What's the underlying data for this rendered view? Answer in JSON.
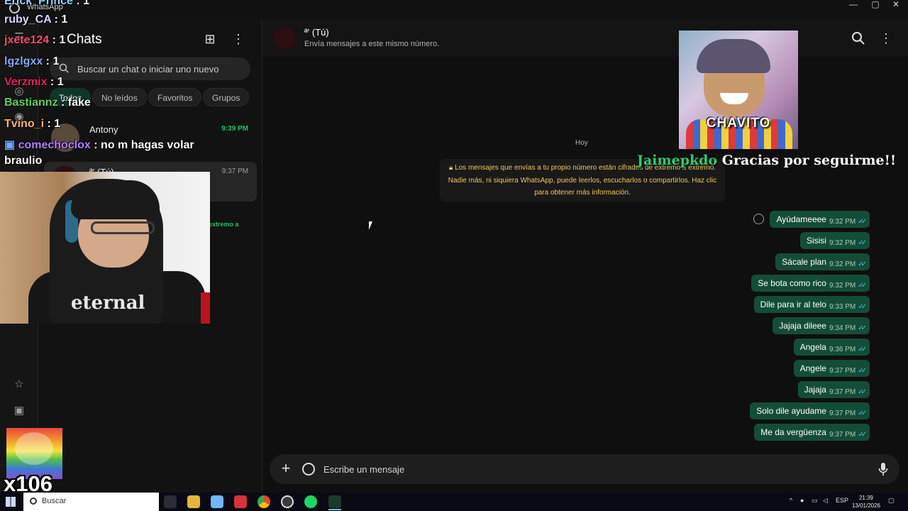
{
  "window": {
    "title": "WhatsApp"
  },
  "chatlist": {
    "title": "Chats",
    "search_placeholder": "Buscar un chat o iniciar uno nuevo",
    "filters": [
      "Todos",
      "No leídos",
      "Favoritos",
      "Grupos"
    ],
    "items": [
      {
        "name": "Antony",
        "time": "9:39 PM"
      },
      {
        "name": "ª' (Tú)",
        "time": "9:37 PM"
      }
    ],
    "snippet": "extremo a"
  },
  "chat": {
    "contact_name": "ª' (Tú)",
    "contact_subtitle": "Envía mensajes a este mismo número.",
    "day_label": "Hoy",
    "encryption_notice": "Los mensajes que envías a tu propio número están cifrados de extremo a extremo. Nadie más, ni siquiera WhatsApp, puede leerlos, escucharlos o compartirlos. Haz clic para obtener más información.",
    "messages": [
      {
        "text": "Ayúdameeee",
        "time": "9:32 PM"
      },
      {
        "text": "Sisisi",
        "time": "9:32 PM"
      },
      {
        "text": "Sácale plan",
        "time": "9:32 PM"
      },
      {
        "text": "Se bota como rico",
        "time": "9:32 PM"
      },
      {
        "text": "Dile para ir al telo",
        "time": "9:33 PM"
      },
      {
        "text": "Jajaja dileee",
        "time": "9:34 PM"
      },
      {
        "text": "Angela",
        "time": "9:36 PM"
      },
      {
        "text": "Angele",
        "time": "9:37 PM"
      },
      {
        "text": "Jajaja",
        "time": "9:37 PM"
      },
      {
        "text": "Solo dile ayudame",
        "time": "9:37 PM"
      },
      {
        "text": "Me da vergüenza",
        "time": "9:37 PM"
      }
    ],
    "composer_placeholder": "Escribe un mensaje"
  },
  "stream_overlay": {
    "chat_lines": [
      {
        "user": "Erick_Prince",
        "text": " : 1",
        "color": "#8fd3ff"
      },
      {
        "user": "ruby_CA",
        "text": " : 1",
        "color": "#d7d7ff"
      },
      {
        "user": "jxete124",
        "text": " : 1",
        "color": "#ff4d6d"
      },
      {
        "user": "lgzlgxx",
        "text": " : 1",
        "color": "#8aa8ff"
      },
      {
        "user": "Verzmix",
        "text": " : 1",
        "color": "#e0245e"
      },
      {
        "user": "Bastiannz",
        "text": " : fake",
        "color": "#5fd35f"
      },
      {
        "user": "Tvino_i",
        "text": " : 1",
        "color": "#ffb36b"
      },
      {
        "user": "comechoclox",
        "text": " : no m hagas volar",
        "color": "#b57dff"
      },
      {
        "user": "braulio",
        "text": "",
        "color": "#ffffff"
      }
    ],
    "alert_image_label": "CHAVITO",
    "follow_user": "Jaimepkdo",
    "follow_text": "Gracias por seguirme!!",
    "sub_count": "x106",
    "webcam_shirt_text": "eternal"
  },
  "taskbar": {
    "search_label": "Buscar",
    "language": "ESP",
    "time": "21:39",
    "date": "13/01/2026"
  },
  "colors": {
    "accent_green": "#21c063",
    "bubble_out": "#144d37",
    "read_ticks": "#53bdeb",
    "notice_text": "#f1c75b"
  },
  "icons": [
    "whatsapp-icon",
    "new-chat-icon",
    "more-vert-icon",
    "search-icon",
    "emoji-icon",
    "plus-icon",
    "sticker-icon",
    "mic-icon",
    "windows-start-icon"
  ]
}
